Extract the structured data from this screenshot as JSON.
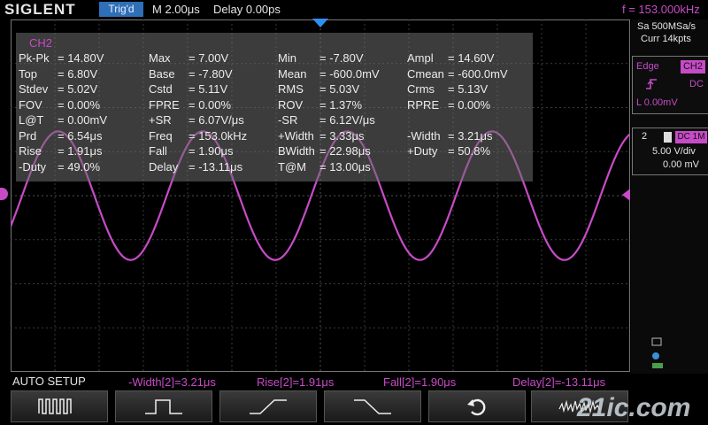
{
  "header": {
    "logo": "SIGLENT",
    "trig_state": "Trig'd",
    "timebase": "M 2.00μs",
    "delay": "Delay 0.00ps",
    "frequency": "f = 153.000kHz"
  },
  "measure": {
    "channel": "CH2",
    "rows": [
      [
        [
          "Pk-Pk",
          "= 14.80V"
        ],
        [
          "Max",
          "= 7.00V"
        ],
        [
          "Min",
          "= -7.80V"
        ],
        [
          "Ampl",
          "= 14.60V"
        ]
      ],
      [
        [
          "Top",
          "= 6.80V"
        ],
        [
          "Base",
          "= -7.80V"
        ],
        [
          "Mean",
          "= -600.0mV"
        ],
        [
          "Cmean",
          "= -600.0mV"
        ]
      ],
      [
        [
          "Stdev",
          "= 5.02V"
        ],
        [
          "Cstd",
          "= 5.11V"
        ],
        [
          "RMS",
          "= 5.03V"
        ],
        [
          "Crms",
          "= 5.13V"
        ]
      ],
      [
        [
          "FOV",
          "= 0.00%"
        ],
        [
          "FPRE",
          "= 0.00%"
        ],
        [
          "ROV",
          "= 1.37%"
        ],
        [
          "RPRE",
          "= 0.00%"
        ]
      ],
      [
        [
          "L@T",
          "= 0.00mV"
        ],
        [
          "+SR",
          "= 6.07V/μs"
        ],
        [
          "-SR",
          "= 6.12V/μs"
        ],
        [
          "",
          ""
        ]
      ],
      [
        [
          "Prd",
          "= 6.54μs"
        ],
        [
          "Freq",
          "= 153.0kHz"
        ],
        [
          "+Width",
          "= 3.33μs"
        ],
        [
          "-Width",
          "= 3.21μs"
        ]
      ],
      [
        [
          "Rise",
          "= 1.91μs"
        ],
        [
          "Fall",
          "= 1.90μs"
        ],
        [
          "BWidth",
          "= 22.98μs"
        ],
        [
          "+Duty",
          "= 50.8%"
        ]
      ],
      [
        [
          "-Duty",
          "= 49.0%"
        ],
        [
          "Delay",
          "= -13.11μs"
        ],
        [
          "T@M",
          "= 13.00μs"
        ],
        [
          "",
          ""
        ]
      ]
    ]
  },
  "acquisition": {
    "sample_rate": "Sa 500MSa/s",
    "memory": "Curr 14kpts"
  },
  "trigger": {
    "type": "Edge",
    "source": "CH2",
    "slope_icon": "rising-edge-icon",
    "coupling": "DC",
    "level": "L  0.00mV"
  },
  "channel": {
    "number": "2",
    "coupling": "DC 1M",
    "scale": "5.00 V/div",
    "offset": "0.00 mV"
  },
  "bottom": {
    "menu_title": "AUTO SETUP",
    "measurements": [
      "-Width[2]=3.21μs",
      "Rise[2]=1.91μs",
      "Fall[2]=1.90μs",
      "Delay[2]=-13.11μs"
    ]
  },
  "softkeys": [
    "multi-period-icon",
    "single-period-icon",
    "rising-edge-icon",
    "falling-edge-icon",
    "undo-icon",
    "noise-waveform-icon"
  ],
  "waveform": {
    "channel": "CH2",
    "color": "#c74bc7",
    "frequency_khz": 153.0,
    "amplitude_v": 7.3,
    "scale_v_per_div": 5.0,
    "timebase_us_per_div": 2.0
  },
  "colors": {
    "ch2": "#c74bc7",
    "trig_state_bg": "#2f6fb7",
    "trigger_marker": "#2f8ff0"
  },
  "watermark": "21ic.com"
}
